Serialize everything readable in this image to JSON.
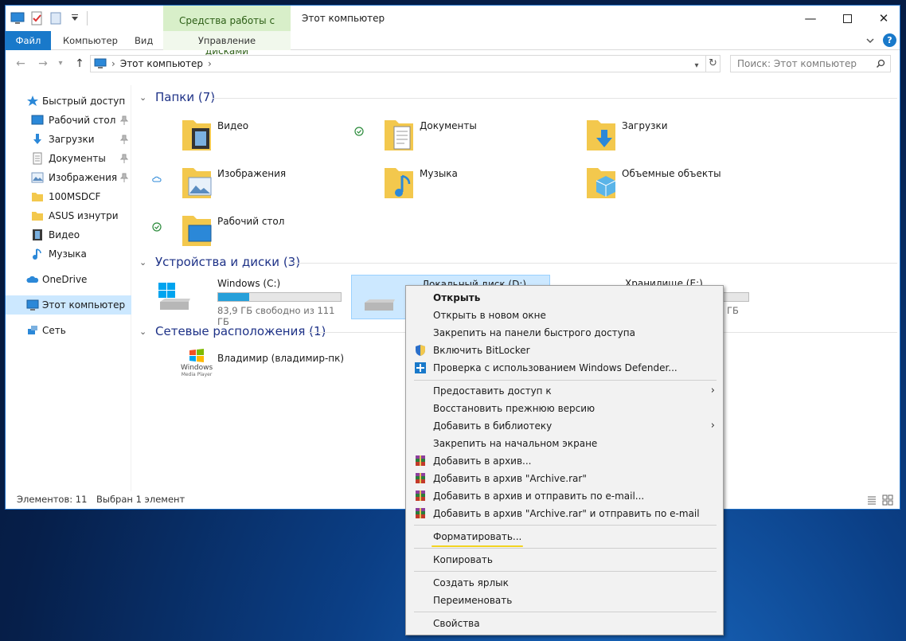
{
  "titlebar": {
    "context_tab_title": "Средства работы с дисками",
    "window_title": "Этот компьютер"
  },
  "ribbon": {
    "tabs": [
      {
        "label": "Файл"
      },
      {
        "label": "Компьютер"
      },
      {
        "label": "Вид"
      },
      {
        "label": "Управление"
      }
    ]
  },
  "address_bar": {
    "path": "Этот компьютер",
    "search_placeholder": "Поиск: Этот компьютер"
  },
  "sidebar": {
    "items": [
      {
        "label": "Быстрый доступ",
        "icon": "star-icon"
      },
      {
        "label": "Рабочий стол",
        "icon": "desktop-icon",
        "pinned": true
      },
      {
        "label": "Загрузки",
        "icon": "download-icon",
        "pinned": true
      },
      {
        "label": "Документы",
        "icon": "document-icon",
        "pinned": true
      },
      {
        "label": "Изображения",
        "icon": "image-icon",
        "pinned": true
      },
      {
        "label": "100MSDCF",
        "icon": "folder-icon"
      },
      {
        "label": "ASUS изнутри",
        "icon": "folder-icon"
      },
      {
        "label": "Видео",
        "icon": "video-icon"
      },
      {
        "label": "Музыка",
        "icon": "music-icon"
      },
      {
        "label": "OneDrive",
        "icon": "cloud-icon"
      },
      {
        "label": "Этот компьютер",
        "icon": "computer-icon",
        "selected": true
      },
      {
        "label": "Сеть",
        "icon": "network-icon"
      }
    ]
  },
  "groups": {
    "folders": {
      "title": "Папки (7)",
      "items": [
        {
          "label": "Видео"
        },
        {
          "label": "Документы"
        },
        {
          "label": "Загрузки"
        },
        {
          "label": "Изображения"
        },
        {
          "label": "Музыка"
        },
        {
          "label": "Объемные объекты"
        },
        {
          "label": "Рабочий стол"
        }
      ]
    },
    "drives": {
      "title": "Устройства и диски (3)",
      "items": [
        {
          "label": "Windows (C:)",
          "free": "83,9 ГБ свободно из 111 ГБ",
          "used_fraction": 0.25
        },
        {
          "label": "Локальный диск (D:)"
        },
        {
          "label": "Хранилище (E:)",
          "free": "ГБ"
        }
      ]
    },
    "network": {
      "title": "Сетевые расположения (1)",
      "items": [
        {
          "label": "Владимир (владимир-пк)",
          "icon_text": "Windows",
          "icon_subtext": "Media Player"
        }
      ]
    }
  },
  "statusbar": {
    "count": "Элементов: 11",
    "selected": "Выбран 1 элемент"
  },
  "context_menu": {
    "items": [
      {
        "label": "Открыть",
        "bold": true
      },
      {
        "label": "Открыть в новом окне"
      },
      {
        "label": "Закрепить на панели быстрого доступа"
      },
      {
        "label": "Включить BitLocker",
        "icon": "shield-icon"
      },
      {
        "label": "Проверка с использованием Windows Defender...",
        "icon": "defender-icon"
      },
      {
        "label": "Предоставить доступ к",
        "submenu": true
      },
      {
        "label": "Восстановить прежнюю версию"
      },
      {
        "label": "Добавить в библиотеку",
        "submenu": true
      },
      {
        "label": "Закрепить на начальном экране"
      },
      {
        "label": "Добавить в архив...",
        "icon": "winrar-icon"
      },
      {
        "label": "Добавить в архив \"Archive.rar\"",
        "icon": "winrar-icon"
      },
      {
        "label": "Добавить в архив и отправить по e-mail...",
        "icon": "winrar-icon"
      },
      {
        "label": "Добавить в архив \"Archive.rar\" и отправить по e-mail",
        "icon": "winrar-icon"
      },
      {
        "label": "Форматировать..."
      },
      {
        "label": "Копировать"
      },
      {
        "label": "Создать ярлык"
      },
      {
        "label": "Переименовать"
      },
      {
        "label": "Свойства"
      }
    ]
  }
}
